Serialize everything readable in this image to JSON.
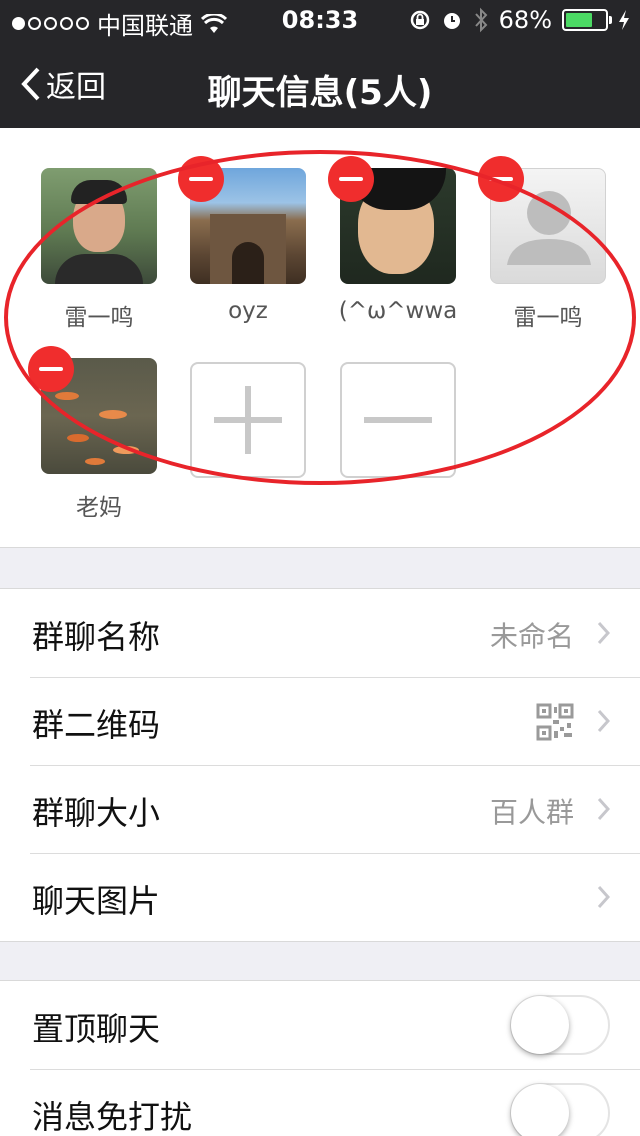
{
  "status_bar": {
    "carrier": "中国联通",
    "time": "08:33",
    "battery_percent": "68%",
    "battery_level": 0.68,
    "signal_bars": 1,
    "icons": [
      "wifi-icon",
      "rotation-lock-icon",
      "alarm-icon",
      "bluetooth-icon",
      "charging-icon"
    ]
  },
  "nav": {
    "back_label": "返回",
    "title": "聊天信息(5人)"
  },
  "members": [
    {
      "name": "雷一鸣",
      "removable": false
    },
    {
      "name": "oyz",
      "removable": true
    },
    {
      "name": "(^ω^wwa",
      "removable": true
    },
    {
      "name": "雷一鸣",
      "removable": true
    },
    {
      "name": "老妈",
      "removable": true
    }
  ],
  "member_actions": [
    "add-member",
    "remove-member"
  ],
  "settings": {
    "group_name": {
      "label": "群聊名称",
      "value": "未命名"
    },
    "qr_code": {
      "label": "群二维码"
    },
    "group_size": {
      "label": "群聊大小",
      "value": "百人群"
    },
    "chat_images": {
      "label": "聊天图片"
    },
    "pin_chat": {
      "label": "置顶聊天",
      "on": false
    },
    "mute": {
      "label": "消息免打扰",
      "on": false
    }
  },
  "colors": {
    "nav_bg": "#262629",
    "delete_badge": "#f02d2d",
    "annotation_ring": "#e8242a",
    "battery_fill": "#4cd964"
  }
}
